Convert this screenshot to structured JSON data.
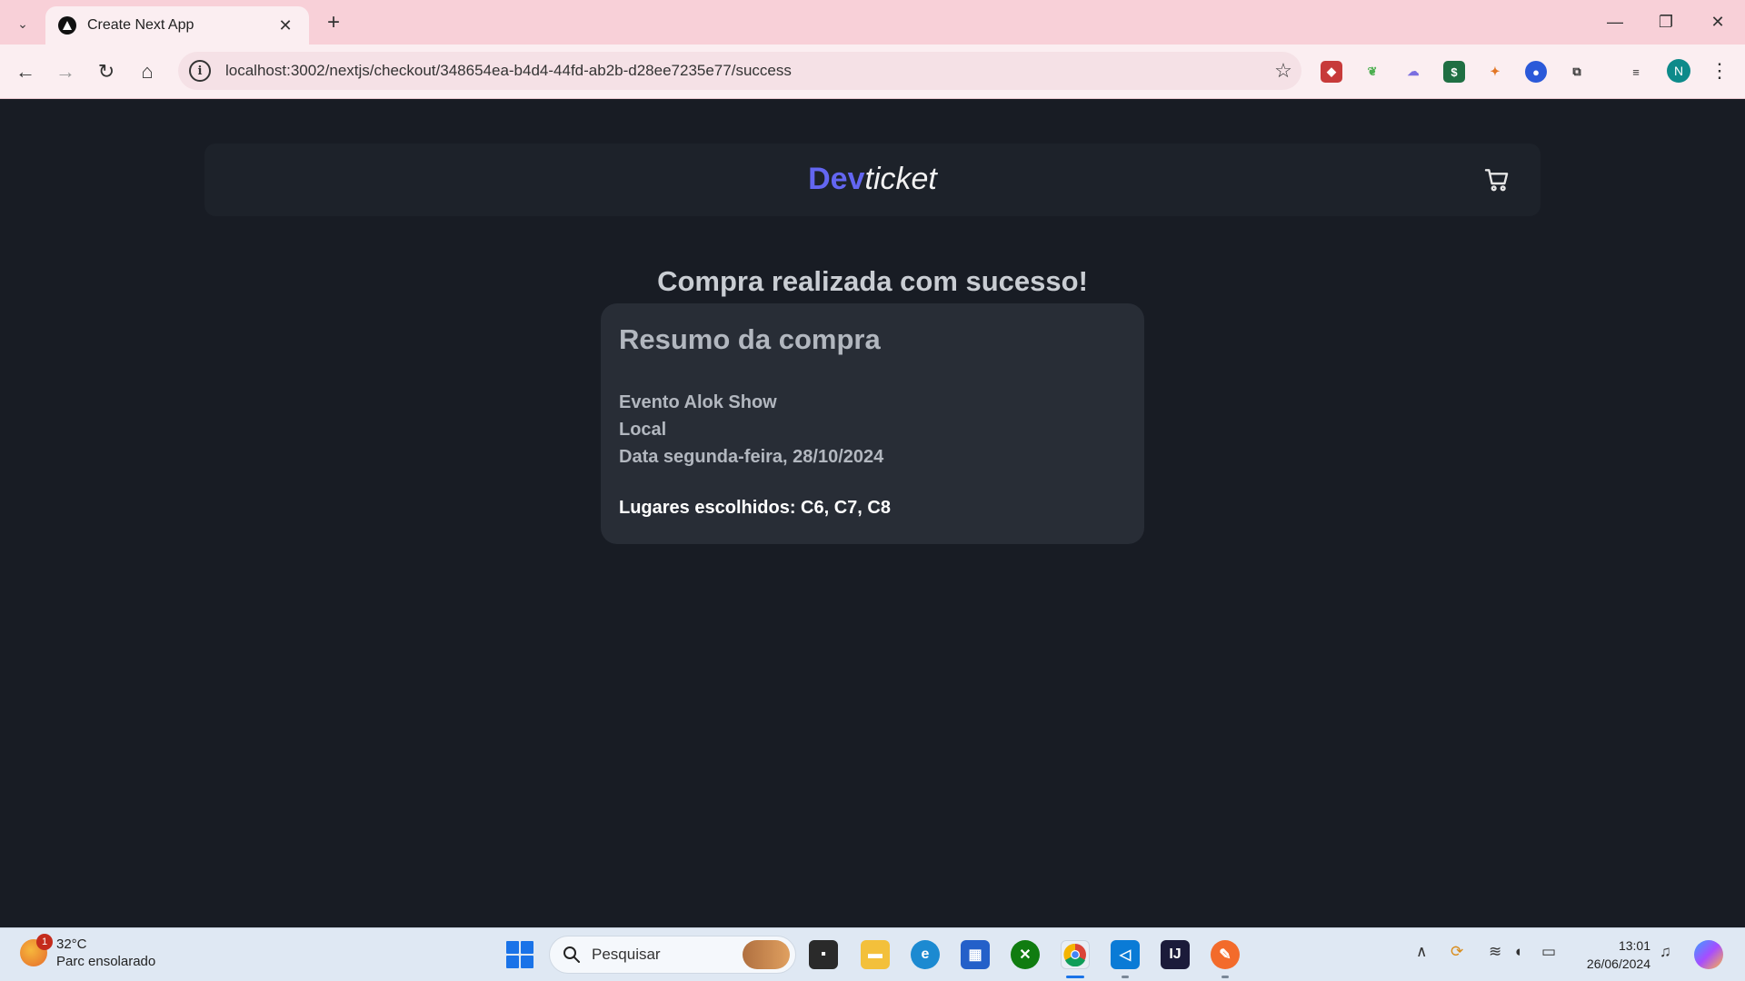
{
  "browser": {
    "tab_title": "Create Next App",
    "url": "localhost:3002/nextjs/checkout/348654ea-b4d4-44fd-ab2b-d28ee7235e77/success",
    "profile_initial": "N",
    "extensions": [
      "red-game-extension",
      "green-leaf-extension",
      "purple-cloud-extension",
      "green-dollar-extension",
      "metamask-fox-extension",
      "blue-circle-extension",
      "puzzle-extensions-icon",
      "media-playlist-icon"
    ]
  },
  "site": {
    "brand_dev": "Dev",
    "brand_ticket": "ticket",
    "brand_color": "#6366f1"
  },
  "success": {
    "title": "Compra realizada com sucesso!",
    "summary_title": "Resumo da compra",
    "event_line": "Evento Alok Show",
    "local_line": "Local",
    "date_line": "Data segunda-feira, 28/10/2024",
    "seats_line": "Lugares escolhidos: C6, C7, C8"
  },
  "taskbar": {
    "weather_temp": "32°C",
    "weather_desc": "Parc ensolarado",
    "weather_badge": "1",
    "search_placeholder": "Pesquisar",
    "time": "13:01",
    "date": "26/06/2024"
  }
}
